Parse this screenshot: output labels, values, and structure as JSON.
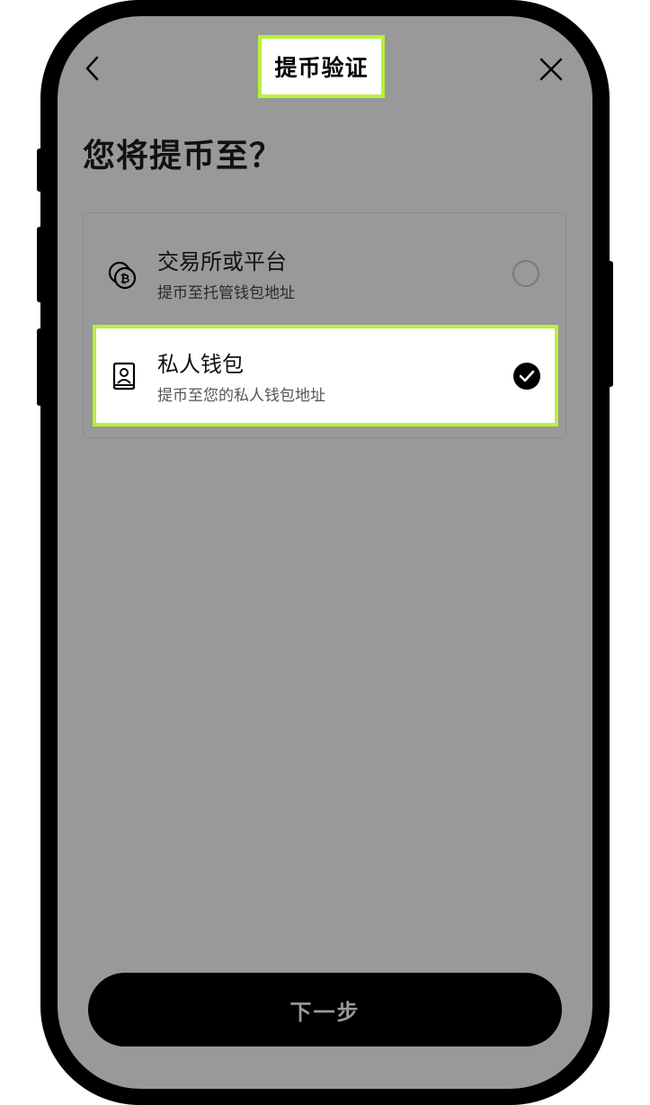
{
  "header": {
    "title": "提币验证",
    "back_icon": "chevron-left-icon",
    "close_icon": "close-icon"
  },
  "question": "您将提币至？",
  "options": [
    {
      "title": "交易所或平台",
      "subtitle": "提币至托管钱包地址",
      "icon": "crypto-coins-icon",
      "selected": false
    },
    {
      "title": "私人钱包",
      "subtitle": "提币至您的私人钱包地址",
      "icon": "wallet-contact-icon",
      "selected": true
    }
  ],
  "footer": {
    "next_label": "下一步"
  },
  "colors": {
    "highlight": "#b8f13a",
    "screen_bg": "#999999",
    "button_bg": "#000000"
  }
}
